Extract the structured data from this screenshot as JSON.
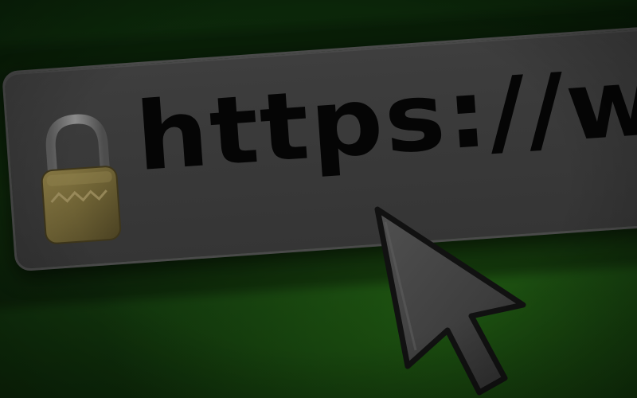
{
  "address_bar": {
    "url_text": "https://www",
    "security_icon": "padlock-icon",
    "cursor_icon": "mouse-pointer-icon"
  },
  "colors": {
    "background": "#153d10",
    "bar": "#3b3b3b",
    "text": "#050505",
    "lock": "#6e6235"
  }
}
